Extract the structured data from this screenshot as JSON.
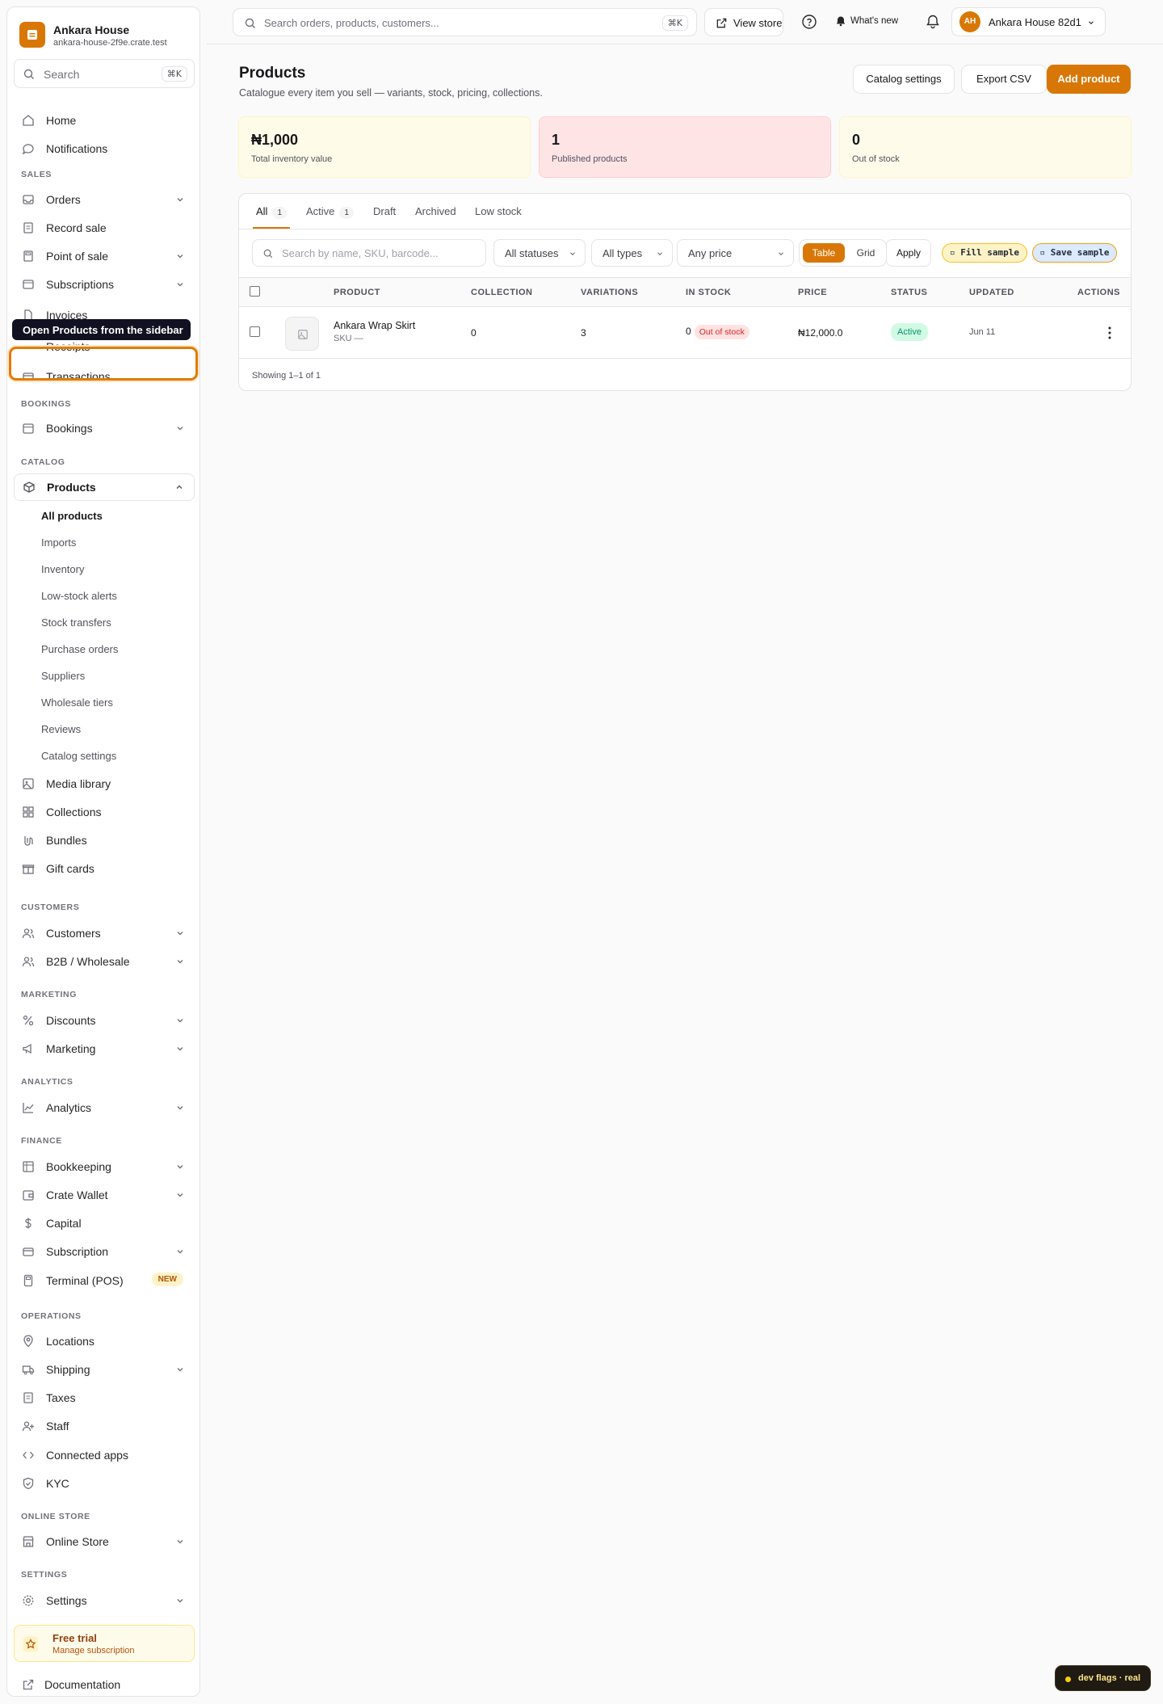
{
  "brand": {
    "name": "Ankara House",
    "domain": "ankara-house-2f9e.crate.test"
  },
  "sidebar": {
    "search": {
      "label": "Search",
      "shortcut": "⌘K"
    },
    "tooltip": "Open Products from the sidebar",
    "items": {
      "home": "Home",
      "notifications": "Notifications",
      "orders": "Orders",
      "record_sale": "Record sale",
      "point_of_sale": "Point of sale",
      "subscriptions": "Subscriptions",
      "invoices": "Invoices",
      "receipts": "Receipts",
      "transactions": "Transactions",
      "bookings": "Bookings",
      "products": "Products",
      "media_library": "Media library",
      "collections": "Collections",
      "bundles": "Bundles",
      "gift_cards": "Gift cards",
      "customers": "Customers",
      "b2b": "B2B / Wholesale",
      "discounts": "Discounts",
      "marketing": "Marketing",
      "analytics": "Analytics",
      "bookkeeping": "Bookkeeping",
      "crate_wallet": "Crate Wallet",
      "capital": "Capital",
      "subscription": "Subscription",
      "terminal": "Terminal (POS)",
      "locations": "Locations",
      "shipping": "Shipping",
      "taxes": "Taxes",
      "staff": "Staff",
      "connected_apps": "Connected apps",
      "kyc": "KYC",
      "online_store": "Online Store",
      "settings": "Settings",
      "documentation": "Documentation"
    },
    "badge_new": "NEW",
    "sections": {
      "sales": "SALES",
      "bookings": "BOOKINGS",
      "catalog": "CATALOG",
      "customers": "CUSTOMERS",
      "marketing": "MARKETING",
      "analytics": "ANALYTICS",
      "finance": "FINANCE",
      "operations": "OPERATIONS",
      "online_store": "ONLINE STORE",
      "settings": "SETTINGS"
    },
    "products_sub": [
      "All products",
      "Imports",
      "Inventory",
      "Low-stock alerts",
      "Stock transfers",
      "Purchase orders",
      "Suppliers",
      "Wholesale tiers",
      "Reviews",
      "Catalog settings"
    ],
    "trial": {
      "title": "Free trial",
      "subtitle": "Manage subscription"
    }
  },
  "topbar": {
    "search_placeholder": "Search orders, products, customers...",
    "search_shortcut": "⌘K",
    "view_store": "View store",
    "whats_new": "What's new",
    "account_initials": "AH",
    "account_name": "Ankara House 82d1"
  },
  "page": {
    "title": "Products",
    "subtitle": "Catalogue every item you sell — variants, stock, pricing, collections.",
    "catalog_settings": "Catalog settings",
    "export_csv": "Export CSV",
    "add_product": "Add product"
  },
  "stats": [
    {
      "value": "₦1,000",
      "label": "Total inventory value"
    },
    {
      "value": "1",
      "label": "Published products"
    },
    {
      "value": "0",
      "label": "Out of stock"
    }
  ],
  "tabs": [
    {
      "label": "All",
      "count": "1"
    },
    {
      "label": "Active",
      "count": "1"
    },
    {
      "label": "Draft"
    },
    {
      "label": "Archived"
    },
    {
      "label": "Low stock"
    }
  ],
  "filters": {
    "search_placeholder": "Search by name, SKU, barcode...",
    "status": "All statuses",
    "type": "All types",
    "price": "Any price",
    "view_table": "Table",
    "view_grid": "Grid",
    "apply": "Apply",
    "fill_sample": "▫ Fill sample",
    "save_sample": "▫ Save sample"
  },
  "table": {
    "columns": [
      "PRODUCT",
      "COLLECTION",
      "VARIATIONS",
      "IN STOCK",
      "PRICE",
      "STATUS",
      "UPDATED",
      "ACTIONS"
    ],
    "rows": [
      {
        "name": "Ankara Wrap Skirt",
        "sku": "SKU —",
        "collection": "0",
        "variations": "3",
        "in_stock": "0",
        "stock_badge": "Out of stock",
        "price": "₦12,000.0",
        "status": "Active",
        "updated": "Jun 11"
      }
    ],
    "showing": "Showing 1–1 of 1"
  },
  "dev_flags": "dev flags · real",
  "colors": {
    "accent": "#d97706",
    "stat1_bg": "#fefce8",
    "stat2_bg": "#ffe4e6",
    "stat3_bg": "#fffbeb",
    "success": "#059669",
    "danger": "#dc2626"
  }
}
